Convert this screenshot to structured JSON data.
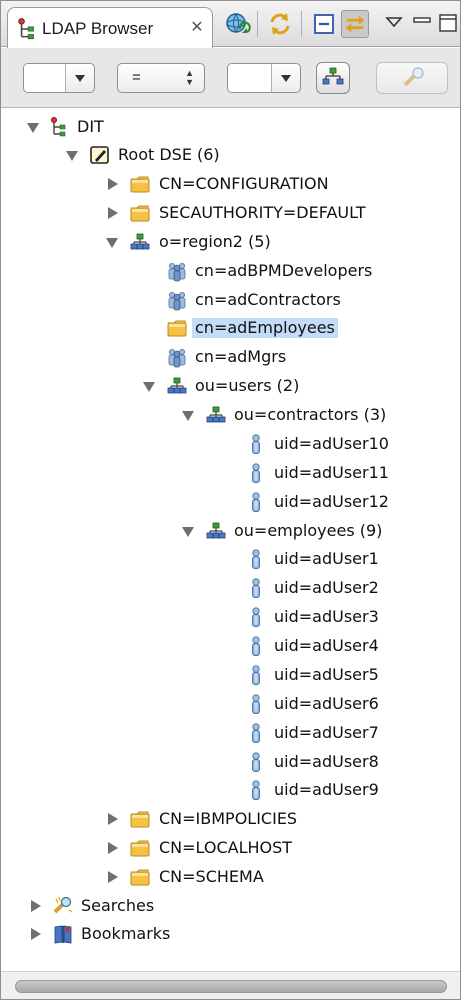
{
  "view": {
    "title": "LDAP Browser",
    "close_glyph": "✕"
  },
  "titlebar_buttons": [
    {
      "name": "refresh-connection-button",
      "icon": "globe-refresh-icon"
    },
    {
      "name": "sync-button",
      "icon": "sync-arrows-icon"
    },
    {
      "name": "collapse-all-button",
      "icon": "collapse-all-icon"
    },
    {
      "name": "link-with-editor-button",
      "icon": "link-arrows-icon",
      "pressed": true
    },
    {
      "name": "view-menu-button",
      "icon": "chevron-down-icon"
    },
    {
      "name": "minimize-button",
      "icon": "minimize-icon"
    },
    {
      "name": "maximize-button",
      "icon": "maximize-icon"
    }
  ],
  "filter_toolbar": {
    "attribute_value": "",
    "operator_value": "=",
    "operator_updown": "▲▼",
    "filter_value": "",
    "apply_button_icon": "tree-filter-icon",
    "clear_button_icon": "clear-filter-icon"
  },
  "tree": {
    "dit": "DIT",
    "root_dse": "Root DSE (6)",
    "cn_configuration": "CN=CONFIGURATION",
    "secauthority": "SECAUTHORITY=DEFAULT",
    "o_region2": "o=region2  (5)",
    "cn_adbpmdevelopers": "cn=adBPMDevelopers",
    "cn_adcontractors": "cn=adContractors",
    "cn_ademployees": "cn=adEmployees",
    "cn_admgrs": "cn=adMgrs",
    "ou_users": "ou=users (2)",
    "ou_contractors": "ou=contractors (3)",
    "uid_aduser10": "uid=adUser10",
    "uid_aduser11": "uid=adUser11",
    "uid_aduser12": "uid=adUser12",
    "ou_employees": "ou=employees (9)",
    "uid_aduser1": "uid=adUser1",
    "uid_aduser2": "uid=adUser2",
    "uid_aduser3": "uid=adUser3",
    "uid_aduser4": "uid=adUser4",
    "uid_aduser5": "uid=adUser5",
    "uid_aduser6": "uid=adUser6",
    "uid_aduser7": "uid=adUser7",
    "uid_aduser8": "uid=adUser8",
    "uid_aduser9": "uid=adUser9",
    "cn_ibmpolicies": "CN=IBMPOLICIES",
    "cn_localhost": "CN=LOCALHOST",
    "cn_schema": "CN=SCHEMA",
    "searches": "Searches",
    "bookmarks": "Bookmarks"
  },
  "colors": {
    "selection": "#c4dcf7",
    "folder": "#f5c242",
    "entry_user": "#7fa8d6",
    "twisty": "#6f6f6f"
  }
}
